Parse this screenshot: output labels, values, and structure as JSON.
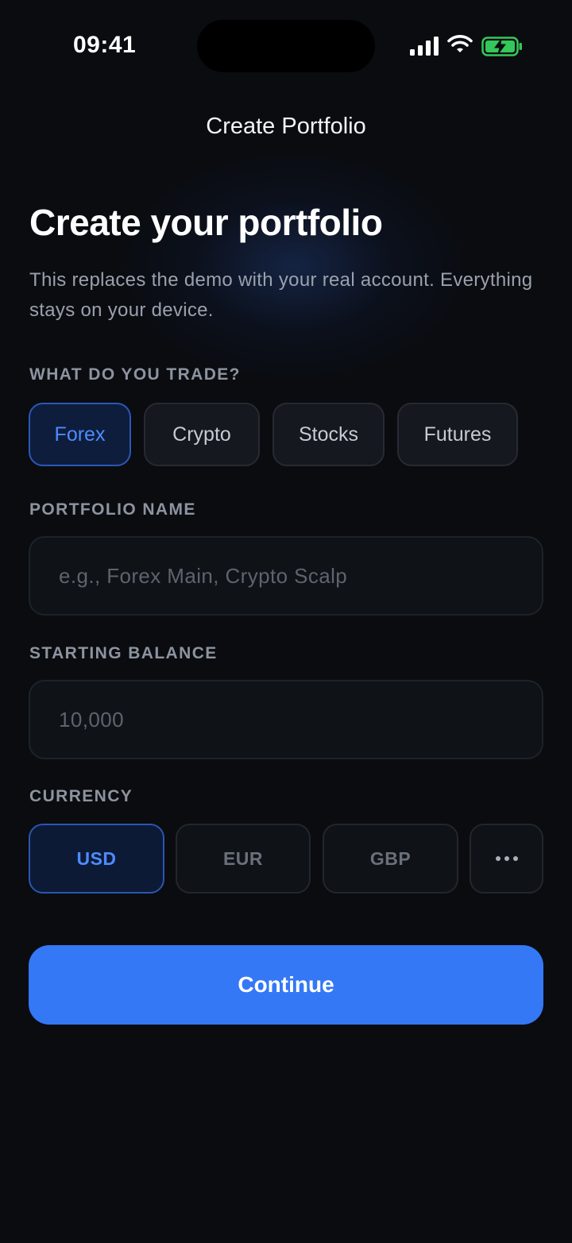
{
  "status_bar": {
    "time": "09:41"
  },
  "nav": {
    "title": "Create Portfolio"
  },
  "heading": "Create your portfolio",
  "subtitle": "This replaces the demo with your real account. Everything stays on your device.",
  "trade_section": {
    "label": "WHAT DO YOU TRADE?",
    "options": [
      "Forex",
      "Crypto",
      "Stocks",
      "Futures"
    ],
    "selected": "Forex"
  },
  "name_section": {
    "label": "PORTFOLIO NAME",
    "value": "",
    "placeholder": "e.g., Forex Main, Crypto Scalp"
  },
  "balance_section": {
    "label": "STARTING BALANCE",
    "value": "",
    "placeholder": "10,000"
  },
  "currency_section": {
    "label": "CURRENCY",
    "options": [
      "USD",
      "EUR",
      "GBP"
    ],
    "selected": "USD",
    "more_icon": "ellipsis-icon"
  },
  "continue_label": "Continue",
  "colors": {
    "accent": "#3478f6",
    "background": "#0a0c10",
    "battery": "#34c759"
  }
}
